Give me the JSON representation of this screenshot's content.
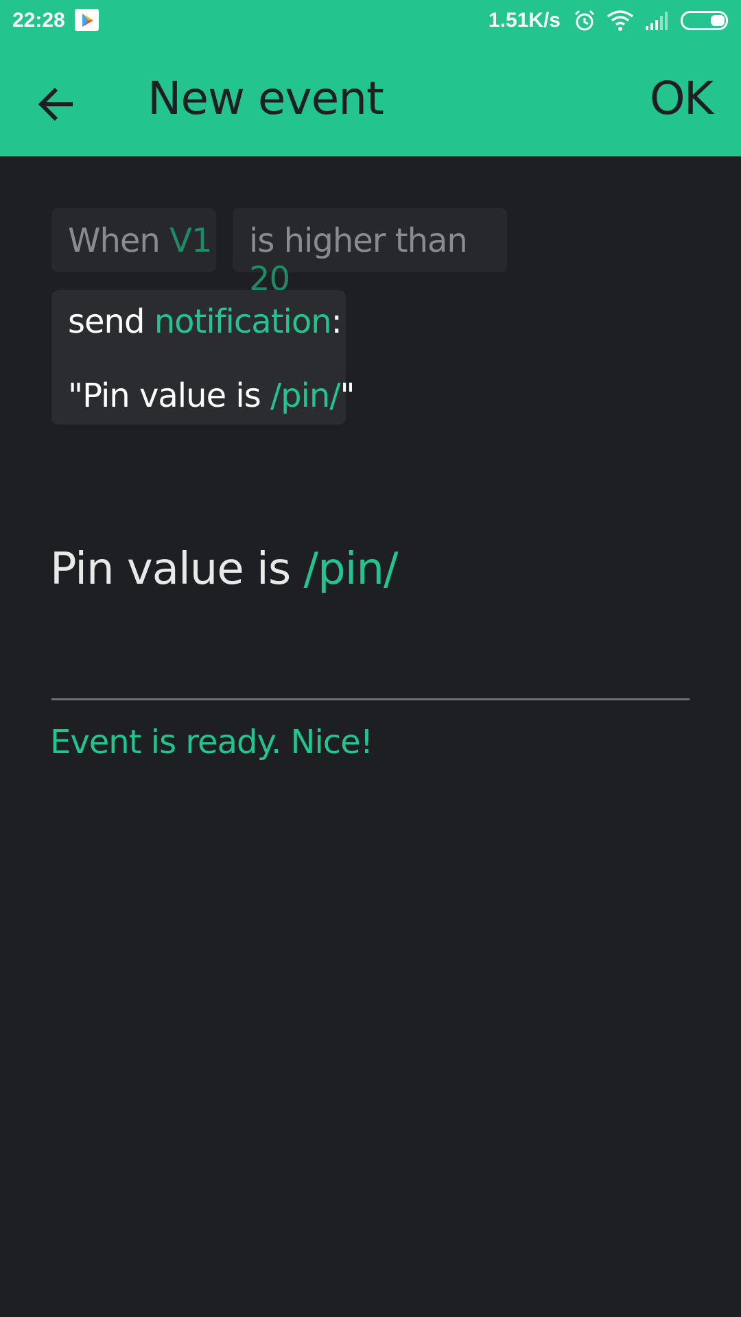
{
  "status_bar": {
    "time": "22:28",
    "network_speed": "1.51K/s",
    "icons": [
      "play-store-icon",
      "alarm-icon",
      "wifi-icon",
      "signal-icon",
      "battery-icon"
    ]
  },
  "app_bar": {
    "title": "New event",
    "ok_label": "OK",
    "back_icon": "arrow-left-icon"
  },
  "condition": {
    "when_label": "When",
    "pin": "V1",
    "operator_label": "is higher than",
    "threshold": "20"
  },
  "action": {
    "send_label": "send",
    "type": "notification",
    "colon": ":",
    "quote_open": "\"Pin value is ",
    "placeholder": "/pin/",
    "quote_close": "\""
  },
  "message_field": {
    "text": "Pin value is ",
    "placeholder_token": "/pin/",
    "helper_text": "Event is ready. Nice!"
  },
  "colors": {
    "accent": "#23c48e",
    "accent_dark": "#1f8a66",
    "background": "#1e1f22",
    "chip": "#26282b"
  }
}
